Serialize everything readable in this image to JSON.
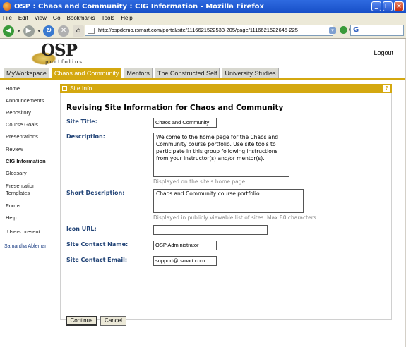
{
  "window": {
    "title": "OSP : Chaos and Community : CIG Information - Mozilla Firefox",
    "controls": [
      "_",
      "□",
      "×"
    ]
  },
  "menubar": {
    "items": [
      "File",
      "Edit",
      "View",
      "Go",
      "Bookmarks",
      "Tools",
      "Help"
    ]
  },
  "toolbar": {
    "url": "http://ospdemo.rsmart.com/portal/site/1116621522533-205/page/1116621522645-225",
    "go_label": "Go",
    "search_logo": "G"
  },
  "header": {
    "logo_main": "OSP",
    "logo_sub": "portfolios",
    "logout_label": "Logout"
  },
  "tabs": [
    {
      "label": "MyWorkspace",
      "active": false
    },
    {
      "label": "Chaos and Community",
      "active": true
    },
    {
      "label": "Mentors",
      "active": false
    },
    {
      "label": "The Constructed Self",
      "active": false
    },
    {
      "label": "University Studies",
      "active": false
    }
  ],
  "sidebar": {
    "items": [
      {
        "label": "Home"
      },
      {
        "label": "Announcements"
      },
      {
        "label": "Repository"
      },
      {
        "label": "Course Goals"
      },
      {
        "label": "Presentations"
      },
      {
        "label": "Review"
      },
      {
        "label": "CIG Information",
        "current": true
      },
      {
        "label": "Glossary"
      },
      {
        "label": "Presentation Templates"
      },
      {
        "label": "Forms"
      },
      {
        "label": "Help"
      }
    ],
    "users_present_label": "Users present:",
    "user": "Samantha Ableman"
  },
  "tool": {
    "header": "Site Info",
    "help_icon": "?"
  },
  "form": {
    "title": "Revising Site Information for Chaos and Community",
    "site_title_label": "Site Title:",
    "site_title_value": "Chaos and Community",
    "description_label": "Description:",
    "description_value": "Welcome to the home page for the Chaos and Community course portfolio. Use site tools to participate in this group following instructions from your instructor(s) and/or mentor(s).",
    "description_hint": "Displayed on the site's home page.",
    "short_description_label": "Short Description:",
    "short_description_value": "Chaos and Community course portfolio",
    "short_description_hint": "Displayed in publicly viewable list of sites. Max 80 characters.",
    "icon_url_label": "Icon URL:",
    "icon_url_value": "",
    "contact_name_label": "Site Contact Name:",
    "contact_name_value": "OSP Administrator",
    "contact_email_label": "Site Contact Email:",
    "contact_email_value": "support@rsmart.com",
    "continue_label": "Continue",
    "cancel_label": "Cancel"
  }
}
